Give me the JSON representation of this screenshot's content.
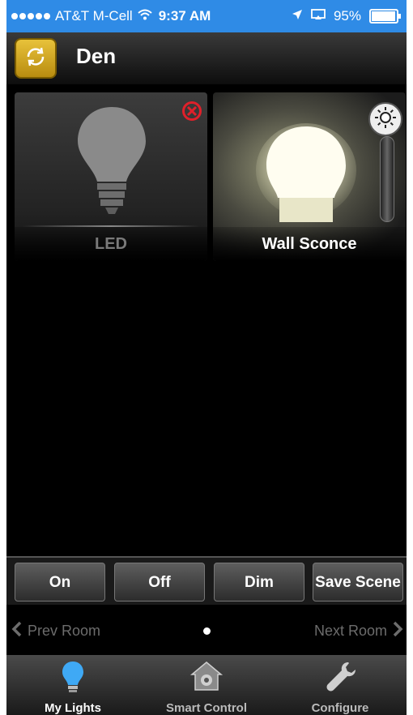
{
  "status_bar": {
    "carrier": "AT&T M-Cell",
    "time": "9:37 AM",
    "battery": "95%"
  },
  "header": {
    "title": "Den"
  },
  "lights": [
    {
      "label": "LED",
      "state": "off",
      "error": true
    },
    {
      "label": "Wall Sconce",
      "state": "on"
    }
  ],
  "controls": {
    "on": "On",
    "off": "Off",
    "dim": "Dim",
    "save_scene": "Save Scene"
  },
  "navigation": {
    "prev": "Prev Room",
    "next": "Next Room"
  },
  "tabs": [
    {
      "label": "My Lights",
      "icon": "bulb-icon",
      "active": true
    },
    {
      "label": "Smart Control",
      "icon": "house-gear-icon",
      "active": false
    },
    {
      "label": "Configure",
      "icon": "wrench-icon",
      "active": false
    }
  ],
  "colors": {
    "status_bar": "#2f8be6",
    "accent": "#e8c23a",
    "bulb_active": "#3fa9f5"
  }
}
